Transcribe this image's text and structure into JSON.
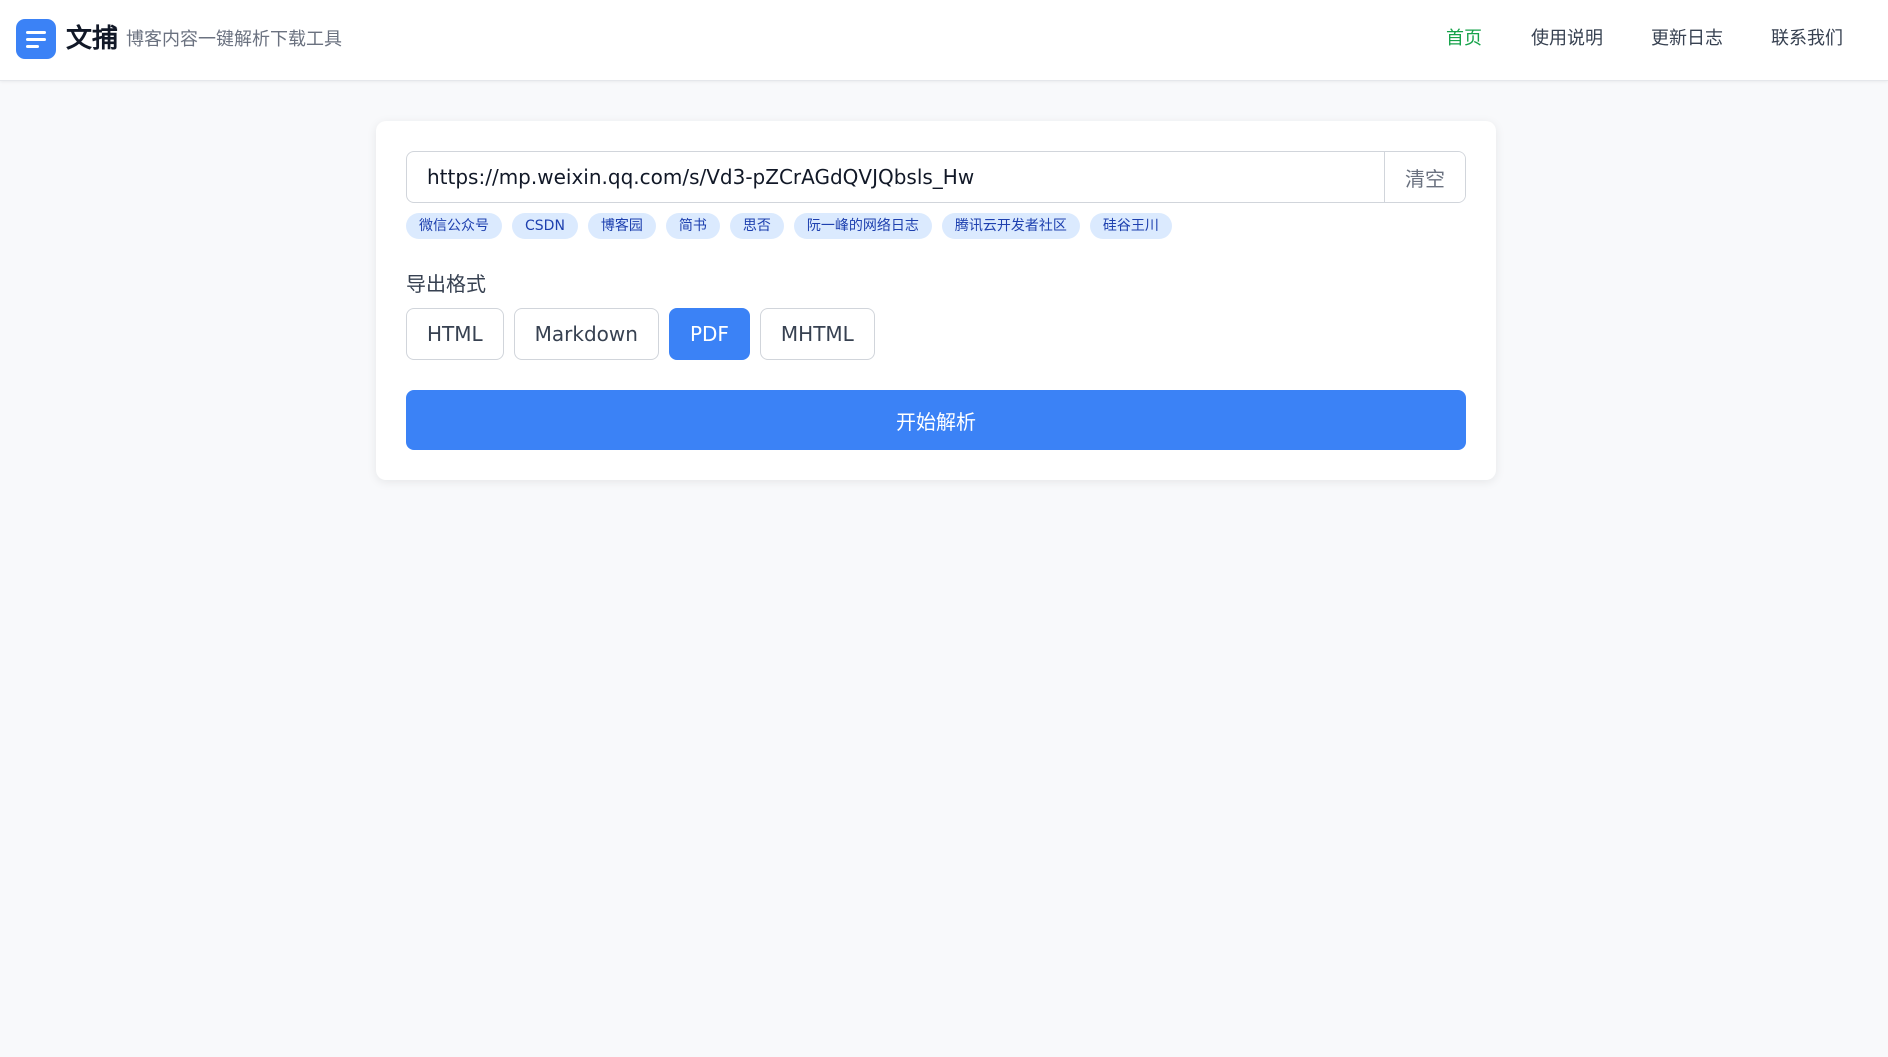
{
  "app": {
    "brand": "文捕",
    "tagline": "博客内容一键解析下载工具",
    "accent": "#3b82f6"
  },
  "nav": {
    "items": [
      {
        "label": "首页",
        "active": true
      },
      {
        "label": "使用说明",
        "active": false
      },
      {
        "label": "更新日志",
        "active": false
      },
      {
        "label": "联系我们",
        "active": false
      }
    ],
    "active_color": "#16a34a"
  },
  "form": {
    "url_value": "https://mp.weixin.qq.com/s/Vd3-pZCrAGdQVJQbsls_Hw",
    "clear_label": "清空",
    "tags": [
      "微信公众号",
      "CSDN",
      "博客园",
      "简书",
      "思否",
      "阮一峰的网络日志",
      "腾讯云开发者社区",
      "硅谷王川"
    ],
    "format_label": "导出格式",
    "formats": [
      {
        "label": "HTML",
        "selected": false
      },
      {
        "label": "Markdown",
        "selected": false
      },
      {
        "label": "PDF",
        "selected": true
      },
      {
        "label": "MHTML",
        "selected": false
      }
    ],
    "start_label": "开始解析"
  }
}
